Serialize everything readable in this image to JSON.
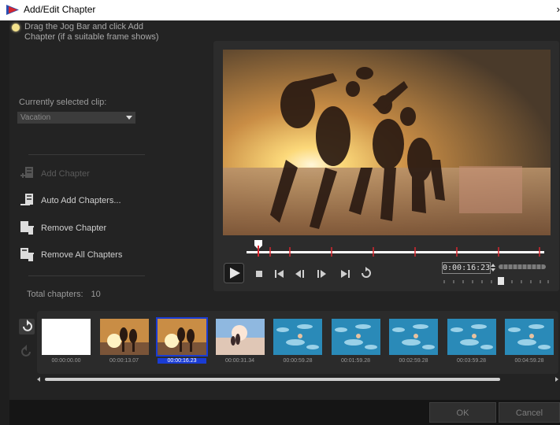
{
  "window": {
    "title": "Add/Edit Chapter",
    "close_glyph": "›"
  },
  "hint": {
    "text": "Drag the Jog Bar and click Add Chapter (if a suitable frame shows)"
  },
  "clip": {
    "label": "Currently selected clip:",
    "value": "Vacation"
  },
  "actions": {
    "add": "Add Chapter",
    "auto_add": "Auto Add Chapters...",
    "remove": "Remove Chapter",
    "remove_all": "Remove All Chapters"
  },
  "total": {
    "label": "Total chapters:",
    "value": "10"
  },
  "player": {
    "timecode": "0:00:16:23",
    "position_fraction": 0.04
  },
  "thumbnails": [
    {
      "time": "00:00:00.00",
      "style": "white"
    },
    {
      "time": "00:00:13.07",
      "style": "sunset"
    },
    {
      "time": "00:00:16.23",
      "style": "sunset",
      "selected": true
    },
    {
      "time": "00:00:31.34",
      "style": "sky"
    },
    {
      "time": "00:00:59.28",
      "style": "pool"
    },
    {
      "time": "00:01:59.28",
      "style": "pool"
    },
    {
      "time": "00:02:59.28",
      "style": "pool"
    },
    {
      "time": "00:03:59.28",
      "style": "pool"
    },
    {
      "time": "00:04:59.28",
      "style": "pool"
    }
  ],
  "buttons": {
    "ok": "OK",
    "cancel": "Cancel"
  }
}
